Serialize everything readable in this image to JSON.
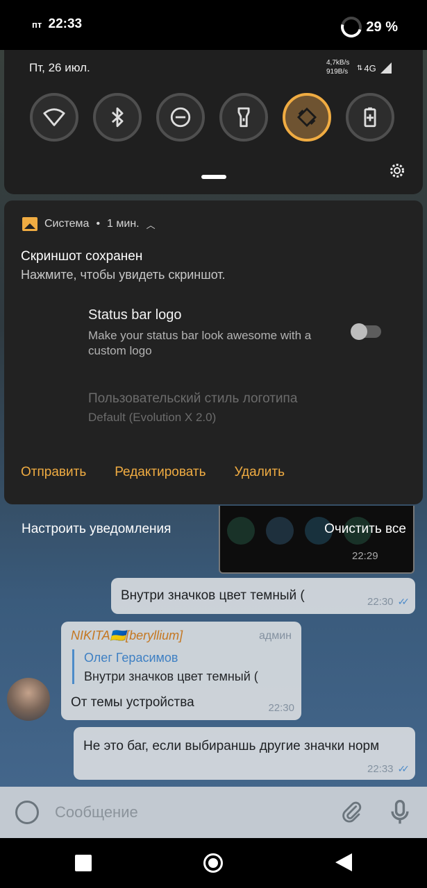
{
  "status_bar": {
    "day": "пт",
    "time": "22:33",
    "battery": "29 %"
  },
  "quick_settings": {
    "date": "Пт, 26 июл.",
    "speed_up": "4,7kB/s",
    "speed_down": "919B/s",
    "network": "4G",
    "tiles": [
      {
        "name": "wifi-icon",
        "active": false
      },
      {
        "name": "bluetooth-icon",
        "active": false
      },
      {
        "name": "do-not-disturb-icon",
        "active": false
      },
      {
        "name": "flashlight-icon",
        "active": false
      },
      {
        "name": "auto-rotate-icon",
        "active": true
      },
      {
        "name": "battery-saver-icon",
        "active": false
      }
    ],
    "accent_color": "#f0ac42"
  },
  "notification": {
    "app": "Система",
    "time": "1 мин.",
    "title": "Скриншот сохранен",
    "subtitle": "Нажмите, чтобы увидеть скриншот.",
    "preview": {
      "title": "Status bar logo",
      "description": "Make your status bar look awesome with a custom logo",
      "style_label": "Пользовательский стиль логотипа",
      "style_value": "Default (Evolution X 2.0)"
    },
    "actions": [
      "Отправить",
      "Редактировать",
      "Удалить"
    ]
  },
  "footer": {
    "manage": "Настроить уведомления",
    "clear_all": "Очистить все"
  },
  "preview_time": "22:29",
  "chat": {
    "messages": [
      {
        "text": "Внутри значков цвет темный (",
        "time": "22:30"
      },
      {
        "sender": "NIKITA🇺🇦[beryllium]",
        "role": "админ",
        "quote_name": "Олег Герасимов",
        "quote_text": "Внутри значков цвет темный (",
        "text": "От темы устройства",
        "time": "22:30"
      },
      {
        "text": "Не это баг, если выбираншь другие значки норм",
        "time": "22:33"
      }
    ],
    "input_placeholder": "Сообщение"
  }
}
